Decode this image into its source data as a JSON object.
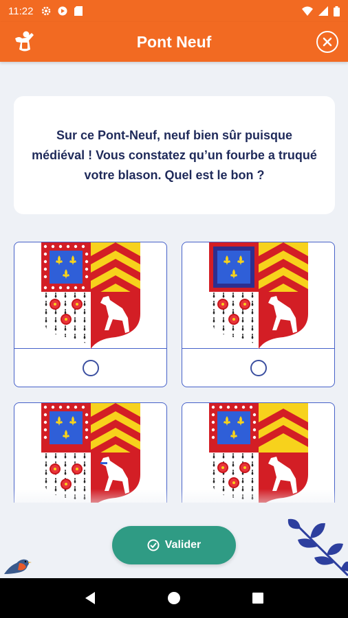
{
  "status": {
    "time": "11:22"
  },
  "header": {
    "title": "Pont Neuf"
  },
  "question": {
    "text": "Sur ce Pont-Neuf, neuf bien sûr  puisque médiéval ! Vous constatez qu’un fourbe a truqué votre blason. Quel est le bon ?"
  },
  "choices": [
    {
      "id": "a",
      "selected": false
    },
    {
      "id": "b",
      "selected": false
    },
    {
      "id": "c",
      "selected": false
    },
    {
      "id": "d",
      "selected": false
    }
  ],
  "actions": {
    "validate_label": "Valider"
  },
  "colors": {
    "accent": "#f26a22",
    "primary_text": "#1f2a5a",
    "button": "#2f9b84",
    "border": "#4560c8"
  }
}
